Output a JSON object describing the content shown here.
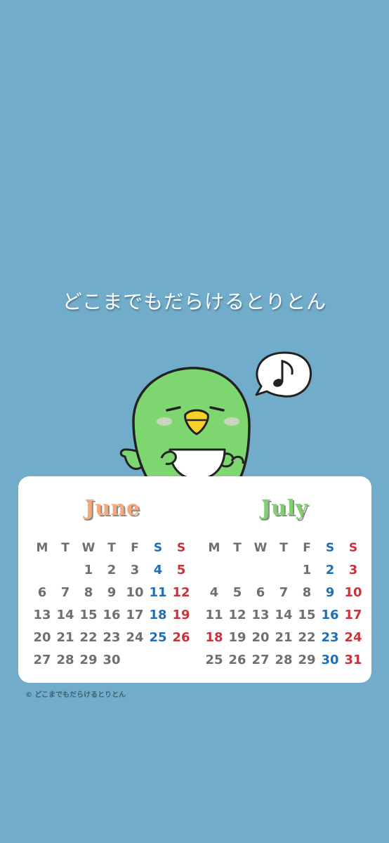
{
  "title": "どこまでもだらけるとりとん",
  "copyright": "© どこまでもだらけるとりとん",
  "colors": {
    "background": "#71adcb",
    "card": "#ffffff",
    "weekday_text": "#6f6f6f",
    "saturday": "#1f6fb5",
    "sunday_holiday": "#c8323a",
    "june_title": "#f7a875",
    "july_title": "#7fd071"
  },
  "weekdays": [
    "M",
    "T",
    "W",
    "T",
    "F",
    "S",
    "S"
  ],
  "months": [
    {
      "name": "June",
      "weeks": [
        [
          "",
          "",
          "1",
          "2",
          "3",
          "4",
          "5"
        ],
        [
          "6",
          "7",
          "8",
          "9",
          "10",
          "11",
          "12"
        ],
        [
          "13",
          "14",
          "15",
          "16",
          "17",
          "18",
          "19"
        ],
        [
          "20",
          "21",
          "22",
          "23",
          "24",
          "25",
          "26"
        ],
        [
          "27",
          "28",
          "29",
          "30",
          "",
          "",
          ""
        ]
      ],
      "holidays": []
    },
    {
      "name": "July",
      "weeks": [
        [
          "",
          "",
          "",
          "",
          "1",
          "2",
          "3"
        ],
        [
          "4",
          "5",
          "6",
          "7",
          "8",
          "9",
          "10"
        ],
        [
          "11",
          "12",
          "13",
          "14",
          "15",
          "16",
          "17"
        ],
        [
          "18",
          "19",
          "20",
          "21",
          "22",
          "23",
          "24"
        ],
        [
          "25",
          "26",
          "27",
          "28",
          "29",
          "30",
          "31"
        ]
      ],
      "holidays": [
        "18"
      ]
    }
  ],
  "mascot": {
    "icon": "green-bird-character-icon",
    "speech_icon": "music-note-icon"
  }
}
